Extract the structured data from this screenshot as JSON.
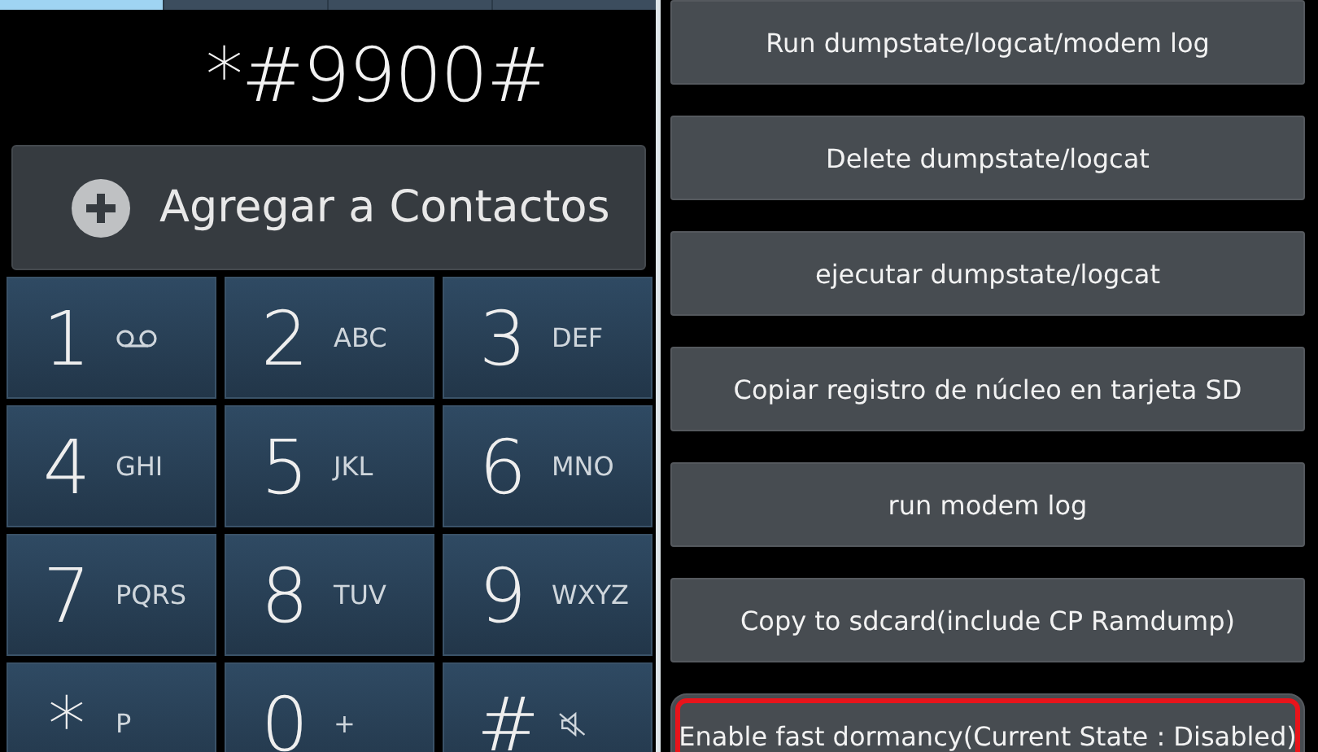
{
  "dialer": {
    "tabs": [
      {
        "selected": true
      },
      {
        "selected": false
      },
      {
        "selected": false
      },
      {
        "selected": false
      }
    ],
    "number": "*#9900#",
    "add_contact": "Agregar a Contactos",
    "keys": [
      {
        "digit": "1",
        "kind": "voicemail"
      },
      {
        "digit": "2",
        "kind": "letters",
        "letters": "ABC"
      },
      {
        "digit": "3",
        "kind": "letters",
        "letters": "DEF"
      },
      {
        "digit": "4",
        "kind": "letters",
        "letters": "GHI"
      },
      {
        "digit": "5",
        "kind": "letters",
        "letters": "JKL"
      },
      {
        "digit": "6",
        "kind": "letters",
        "letters": "MNO"
      },
      {
        "digit": "7",
        "kind": "letters",
        "letters": "PQRS"
      },
      {
        "digit": "8",
        "kind": "letters",
        "letters": "TUV"
      },
      {
        "digit": "9",
        "kind": "letters",
        "letters": "WXYZ"
      },
      {
        "digit": "*",
        "kind": "letters",
        "letters": "P"
      },
      {
        "digit": "0",
        "kind": "letters",
        "letters": "+"
      },
      {
        "digit": "#",
        "kind": "silent"
      }
    ]
  },
  "sysdump": {
    "buttons": [
      {
        "label": "Run dumpstate/logcat/modem log",
        "highlighted": false
      },
      {
        "label": "Delete dumpstate/logcat",
        "highlighted": false
      },
      {
        "label": "ejecutar dumpstate/logcat",
        "highlighted": false
      },
      {
        "label": "Copiar registro de núcleo en tarjeta SD",
        "highlighted": false
      },
      {
        "label": "run modem log",
        "highlighted": false
      },
      {
        "label": "Copy to sdcard(include CP Ramdump)",
        "highlighted": false
      },
      {
        "label": "Enable fast dormancy(Current State : Disabled)",
        "highlighted": true
      }
    ]
  }
}
